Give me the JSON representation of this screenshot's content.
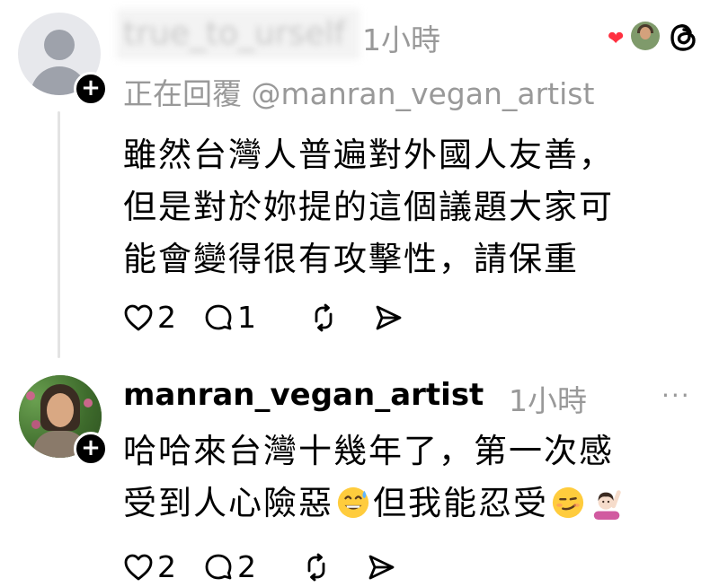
{
  "header": {
    "liked_icon": "heart-icon",
    "app_icon": "threads-icon"
  },
  "post1": {
    "username": "true_to_urself",
    "time": "1小時",
    "reply_to": "正在回覆 @manran_vegan_artist",
    "lines": [
      "雖然台灣人普遍對外國人友善，",
      "但是對於妳提的這個議題大家可",
      "能會變得很有攻擊性，請保重"
    ],
    "likes": "2",
    "comments": "1"
  },
  "post2": {
    "username": "manran_vegan_artist",
    "time": "1小時",
    "more": "···",
    "line1": "哈哈來台灣十幾年了，第一次感",
    "line2_a": "受到人心險惡",
    "line2_b": "但我能忍受",
    "emojis": [
      "grinning-face-with-sweat",
      "smirking-face",
      "person-raising-hand"
    ],
    "likes": "2",
    "comments": "2"
  }
}
